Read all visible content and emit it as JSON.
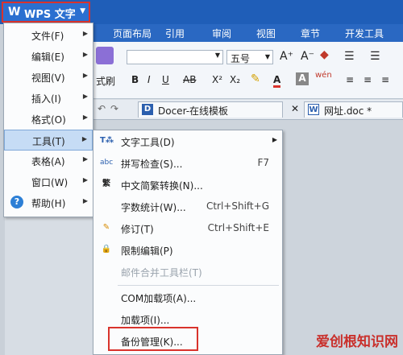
{
  "app": {
    "logo": "W",
    "title": "WPS 文字"
  },
  "ribbon_tabs": [
    "页面布局",
    "引用",
    "审阅",
    "视图",
    "章节",
    "开发工具"
  ],
  "ribbon": {
    "font_size": "五号",
    "paste_label": "式刷",
    "bold": "B",
    "italic": "I",
    "underline": "U",
    "strike": "AB",
    "superscript": "X²",
    "subscript": "X₂",
    "font_color": "A",
    "grow": "A⁺",
    "shrink": "A⁻"
  },
  "doc_tabs": [
    {
      "label": "Docer-在线模板",
      "close": "✕"
    },
    {
      "label": "网址.doc *"
    }
  ],
  "main_menu": [
    {
      "label": "文件(F)"
    },
    {
      "label": "编辑(E)"
    },
    {
      "label": "视图(V)"
    },
    {
      "label": "插入(I)"
    },
    {
      "label": "格式(O)"
    },
    {
      "label": "工具(T)",
      "selected": true
    },
    {
      "label": "表格(A)"
    },
    {
      "label": "窗口(W)"
    },
    {
      "label": "帮助(H)"
    }
  ],
  "tools_menu": [
    {
      "label": "文字工具(D)",
      "shortcut": "",
      "icon": "text-tools-icon",
      "arrow": true
    },
    {
      "label": "拼写检查(S)...",
      "shortcut": "F7",
      "icon": "spellcheck-icon"
    },
    {
      "label": "中文简繁转换(N)...",
      "shortcut": "",
      "icon": "convert-icon"
    },
    {
      "label": "字数统计(W)...",
      "shortcut": "Ctrl+Shift+G",
      "icon": ""
    },
    {
      "label": "修订(T)",
      "shortcut": "Ctrl+Shift+E",
      "icon": "revision-icon"
    },
    {
      "label": "限制编辑(P)",
      "shortcut": "",
      "icon": "lock-icon"
    },
    {
      "label": "邮件合并工具栏(T)",
      "shortcut": "",
      "icon": "",
      "disabled": true
    },
    {
      "label": "COM加载项(A)...",
      "shortcut": "",
      "icon": ""
    },
    {
      "label": "加载项(I)...",
      "shortcut": "",
      "icon": ""
    },
    {
      "label": "备份管理(K)...",
      "shortcut": "",
      "icon": "",
      "highlighted": true
    }
  ],
  "watermark": "爱创根知识网",
  "colors": {
    "accent": "#1f5eb8",
    "highlight_border": "#d9332c",
    "selection": "#c6dcf5"
  }
}
